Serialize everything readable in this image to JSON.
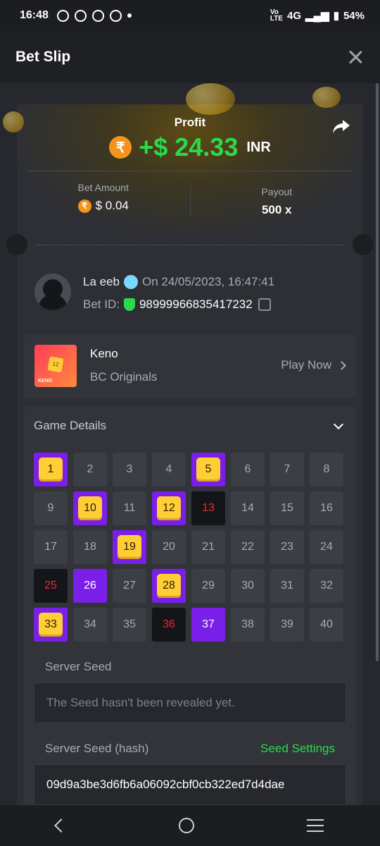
{
  "status_bar": {
    "time": "16:48",
    "battery": "54%",
    "network": "4G"
  },
  "header": {
    "title": "Bet Slip"
  },
  "profit": {
    "label": "Profit",
    "amount": "+$ 24.33",
    "currency": "INR",
    "currency_symbol": "₹"
  },
  "bet_amount": {
    "label": "Bet Amount",
    "value": "$ 0.04"
  },
  "payout": {
    "label": "Payout",
    "value": "500 x"
  },
  "user": {
    "name": "La eeb",
    "date": "On 24/05/2023, 16:47:41",
    "bet_id_label": "Bet ID:",
    "bet_id": "98999966835417232"
  },
  "game": {
    "name": "Keno",
    "provider": "BC Originals",
    "play_label": "Play Now",
    "thumb_number": "12",
    "thumb_label": "KENO"
  },
  "details": {
    "title": "Game Details",
    "cells": [
      {
        "n": "1",
        "state": "hit"
      },
      {
        "n": "2",
        "state": "none"
      },
      {
        "n": "3",
        "state": "none"
      },
      {
        "n": "4",
        "state": "none"
      },
      {
        "n": "5",
        "state": "hit"
      },
      {
        "n": "6",
        "state": "none"
      },
      {
        "n": "7",
        "state": "none"
      },
      {
        "n": "8",
        "state": "none"
      },
      {
        "n": "9",
        "state": "none"
      },
      {
        "n": "10",
        "state": "hit"
      },
      {
        "n": "11",
        "state": "none"
      },
      {
        "n": "12",
        "state": "hit"
      },
      {
        "n": "13",
        "state": "miss"
      },
      {
        "n": "14",
        "state": "none"
      },
      {
        "n": "15",
        "state": "none"
      },
      {
        "n": "16",
        "state": "none"
      },
      {
        "n": "17",
        "state": "none"
      },
      {
        "n": "18",
        "state": "none"
      },
      {
        "n": "19",
        "state": "hit"
      },
      {
        "n": "20",
        "state": "none"
      },
      {
        "n": "21",
        "state": "none"
      },
      {
        "n": "22",
        "state": "none"
      },
      {
        "n": "23",
        "state": "none"
      },
      {
        "n": "24",
        "state": "none"
      },
      {
        "n": "25",
        "state": "miss"
      },
      {
        "n": "26",
        "state": "picked"
      },
      {
        "n": "27",
        "state": "none"
      },
      {
        "n": "28",
        "state": "hit"
      },
      {
        "n": "29",
        "state": "none"
      },
      {
        "n": "30",
        "state": "none"
      },
      {
        "n": "31",
        "state": "none"
      },
      {
        "n": "32",
        "state": "none"
      },
      {
        "n": "33",
        "state": "hit"
      },
      {
        "n": "34",
        "state": "none"
      },
      {
        "n": "35",
        "state": "none"
      },
      {
        "n": "36",
        "state": "miss"
      },
      {
        "n": "37",
        "state": "picked"
      },
      {
        "n": "38",
        "state": "none"
      },
      {
        "n": "39",
        "state": "none"
      },
      {
        "n": "40",
        "state": "none"
      }
    ],
    "server_seed_label": "Server Seed",
    "server_seed_value": "The Seed hasn't been revealed yet.",
    "server_hash_label": "Server Seed (hash)",
    "seed_settings_label": "Seed Settings",
    "server_hash_value": "09d9a3be3d6fb6a06092cbf0cb322ed7d4dae"
  },
  "colors": {
    "accent_green": "#2bd94a",
    "purple": "#7a1fe8",
    "miss_red": "#e5283a",
    "gem_yellow": "#ffcd36"
  }
}
